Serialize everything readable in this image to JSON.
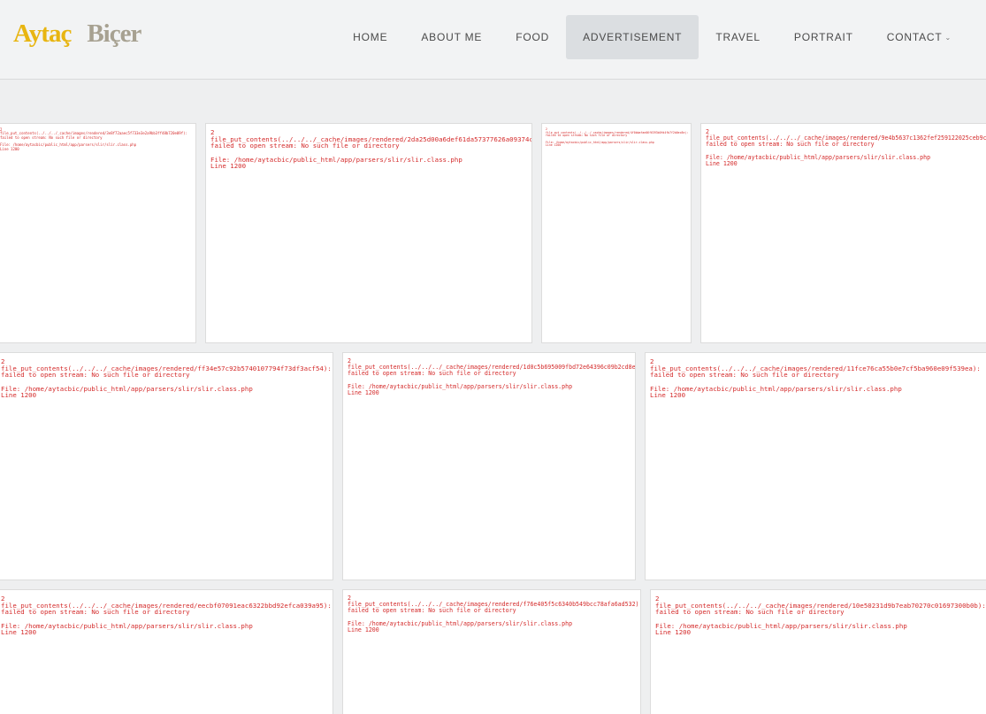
{
  "logo": {
    "first": "Aytaç",
    "last": "Biçer"
  },
  "nav": [
    {
      "label": "HOME",
      "active": false
    },
    {
      "label": "ABOUT ME",
      "active": false
    },
    {
      "label": "FOOD",
      "active": false
    },
    {
      "label": "ADVERTISEMENT",
      "active": true
    },
    {
      "label": "TRAVEL",
      "active": false
    },
    {
      "label": "PORTRAIT",
      "active": false
    },
    {
      "label": "CONTACT",
      "active": false,
      "dropdown": true
    }
  ],
  "error_common": {
    "code": "2",
    "stream": "failed to open stream: No such file or directory",
    "file": "File: /home/aytacbic/public_html/app/parsers/slir/slir.class.php",
    "line": "Line 1200"
  },
  "tiles": [
    {
      "hash": "3e8f72aaec5f733e3e2a9bb3ff48b720e09f"
    },
    {
      "hash": "2da25d00a6def61da57377626a09374c"
    },
    {
      "hash": "4f0bbafae06f6393b0fd4fb7f2b0ec8e"
    },
    {
      "hash": "9e4b5637c1362fef259122025ceb9cd0"
    },
    {
      "hash": "ff34e57c92b5740107794f73df3acf54"
    },
    {
      "hash": "1d0c5b695009fbd72e64396c09b2cd8e"
    },
    {
      "hash": "11fce76ca55b0e7cf5ba960e09f539ea"
    },
    {
      "hash": "eecbf07091eac6322bbd92efca039a95"
    },
    {
      "hash": "f76e405f5c6340b549bcc78afa6ad532"
    },
    {
      "hash": "10e50231d9b7eab70270c01697300b0b"
    }
  ]
}
